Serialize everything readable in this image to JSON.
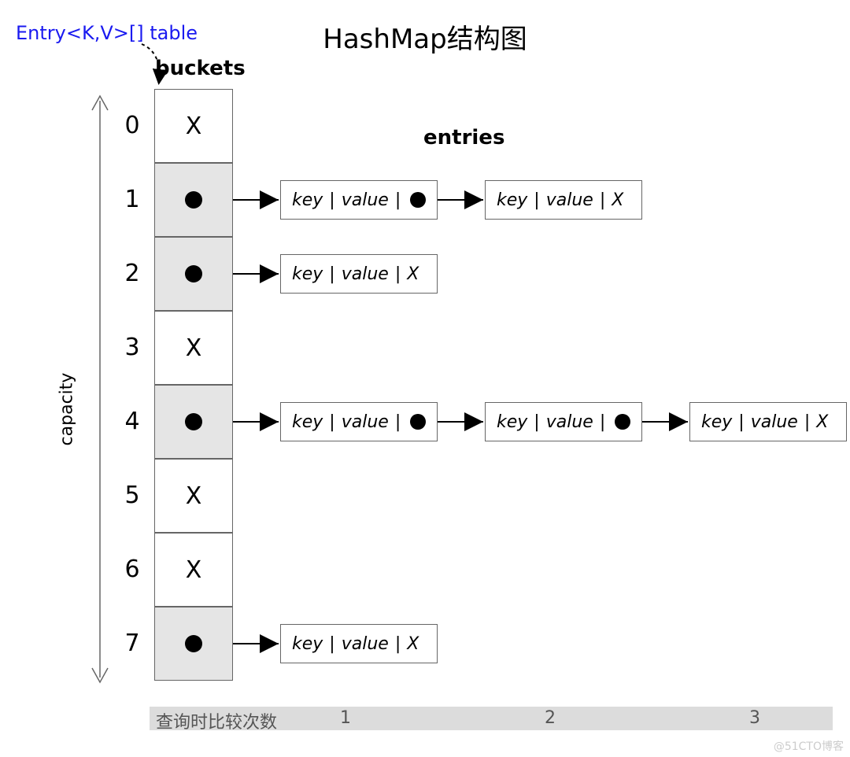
{
  "title": "HashMap结构图",
  "labels": {
    "table": "Entry<K,V>[] table",
    "buckets": "buckets",
    "entries": "entries",
    "capacity": "capacity"
  },
  "buckets": [
    {
      "index": 0,
      "state": "empty",
      "display": "X",
      "chain": []
    },
    {
      "index": 1,
      "state": "filled",
      "display": "dot",
      "chain": [
        {
          "key": "key",
          "value": "value",
          "next": "dot"
        },
        {
          "key": "key",
          "value": "value",
          "next": "X"
        }
      ]
    },
    {
      "index": 2,
      "state": "filled",
      "display": "dot",
      "chain": [
        {
          "key": "key",
          "value": "value",
          "next": "X"
        }
      ]
    },
    {
      "index": 3,
      "state": "empty",
      "display": "X",
      "chain": []
    },
    {
      "index": 4,
      "state": "filled",
      "display": "dot",
      "chain": [
        {
          "key": "key",
          "value": "value",
          "next": "dot"
        },
        {
          "key": "key",
          "value": "value",
          "next": "dot"
        },
        {
          "key": "key",
          "value": "value",
          "next": "X"
        }
      ]
    },
    {
      "index": 5,
      "state": "empty",
      "display": "X",
      "chain": []
    },
    {
      "index": 6,
      "state": "empty",
      "display": "X",
      "chain": []
    },
    {
      "index": 7,
      "state": "filled",
      "display": "dot",
      "chain": [
        {
          "key": "key",
          "value": "value",
          "next": "X"
        }
      ]
    }
  ],
  "entry_separator": " | ",
  "bottom": {
    "label": "查询时比较次数",
    "values": [
      "1",
      "2",
      "3"
    ]
  },
  "watermark": "@51CTO博客",
  "chart_data": {
    "type": "table",
    "description": "HashMap bucket array with linked-list chains",
    "capacity": 8,
    "buckets": {
      "0": null,
      "1": [
        "entry",
        "entry"
      ],
      "2": [
        "entry"
      ],
      "3": null,
      "4": [
        "entry",
        "entry",
        "entry"
      ],
      "5": null,
      "6": null,
      "7": [
        "entry"
      ]
    },
    "chain_length": {
      "0": 0,
      "1": 2,
      "2": 1,
      "3": 0,
      "4": 3,
      "5": 0,
      "6": 0,
      "7": 1
    },
    "lookup_comparisons_axis": [
      1,
      2,
      3
    ]
  }
}
